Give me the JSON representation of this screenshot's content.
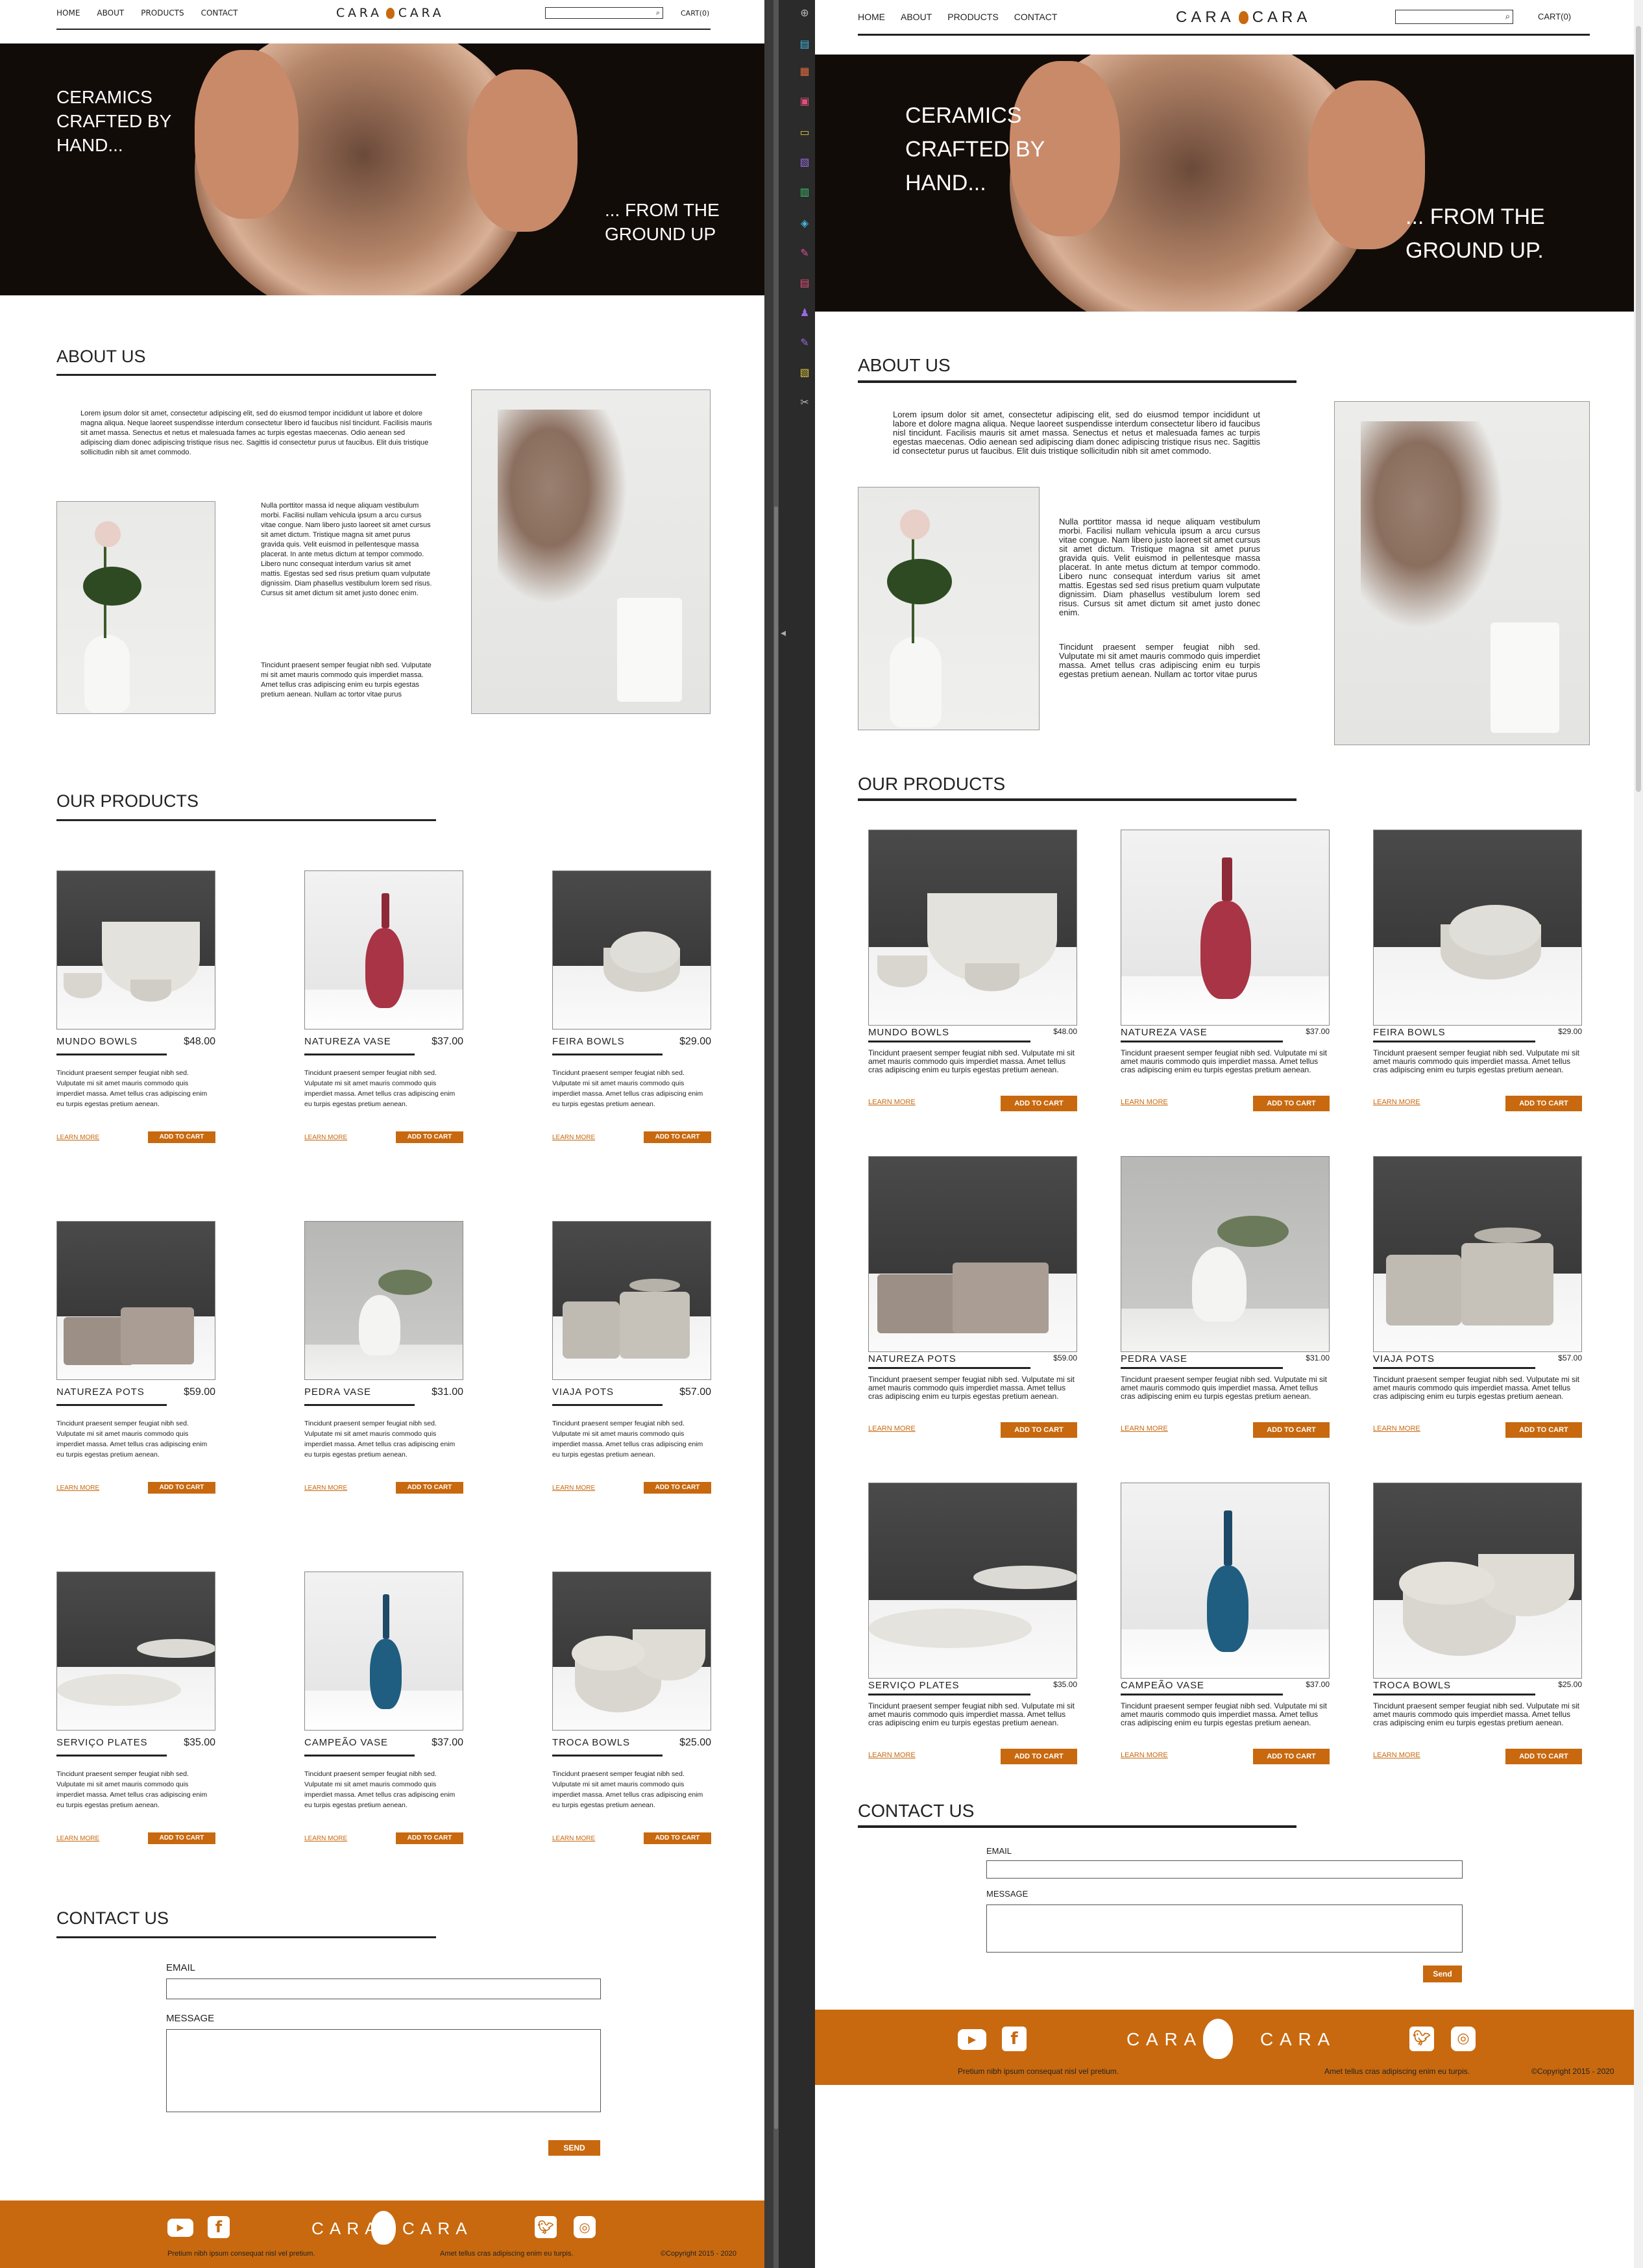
{
  "site": {
    "nav": [
      "HOME",
      "ABOUT",
      "PRODUCTS",
      "CONTACT"
    ],
    "logo_left": "CARA",
    "logo_right": "CARA",
    "cart": "CART(0)",
    "hero_line1": "CERAMICS\nCRAFTED BY\nHAND...",
    "about_title": "ABOUT US",
    "about_p1": "Lorem ipsum dolor sit amet, consectetur adipiscing elit, sed do eiusmod tempor incididunt ut labore et dolore magna aliqua. Neque laoreet suspendisse interdum consectetur libero id faucibus nisl tincidunt. Facilisis mauris sit amet massa. Senectus et netus et malesuada fames ac turpis egestas maecenas. Odio aenean sed adipiscing diam donec adipiscing tristique risus nec. Sagittis id consectetur purus ut faucibus. Elit duis tristique sollicitudin nibh sit amet commodo.",
    "about_p2": "Nulla porttitor massa id neque aliquam vestibulum morbi. Facilisi nullam vehicula ipsum a arcu cursus vitae congue. Nam libero justo laoreet sit amet cursus sit amet dictum. Tristique magna sit amet purus gravida quis. Velit euismod in pellentesque massa placerat. In ante metus dictum at tempor commodo. Libero nunc consequat interdum varius sit amet mattis. Egestas sed sed risus pretium quam vulputate dignissim. Diam phasellus vestibulum lorem sed risus. Cursus sit amet dictum sit amet justo donec enim.",
    "about_p3": "Tincidunt praesent semper feugiat nibh sed. Vulputate mi sit amet mauris commodo quis imperdiet massa. Amet tellus cras adipiscing enim eu turpis egestas pretium aenean. Nullam ac tortor vitae purus",
    "products_title": "OUR PRODUCTS",
    "product_desc": "Tincidunt praesent semper feugiat nibh sed. Vulputate mi sit amet mauris commodo quis imperdiet massa. Amet tellus cras adipiscing enim eu turpis egestas pretium aenean.",
    "learn_more": "LEARN MORE",
    "add_to_cart": "ADD TO CART",
    "contact_title": "CONTACT US",
    "email_label": "EMAIL",
    "message_label": "MESSAGE",
    "footer_left": "Pretium nibh ipsum consequat nisl vel pretium.",
    "footer_mid": "Amet tellus cras adipiscing enim eu turpis.",
    "footer_copy": "©Copyright 2015 - 2020"
  },
  "left": {
    "hero_line2": "... FROM THE\nGROUND UP",
    "send": "SEND"
  },
  "right": {
    "hero_line2": "... FROM THE\nGROUND UP.",
    "send": "Send"
  },
  "products": [
    {
      "name": "MUNDO BOWLS",
      "price_left": "$48.00",
      "price_right": "$48.00",
      "kind": "bowls"
    },
    {
      "name": "NATUREZA VASE",
      "price_left": "$37.00",
      "price_right": "$37.00",
      "kind": "redvase"
    },
    {
      "name": "FEIRA BOWLS",
      "price_left": "$29.00",
      "price_right": "$29.00",
      "kind": "stackbowls"
    },
    {
      "name": "NATUREZA POTS",
      "price_left": "$59.00",
      "price_right": "$59.00",
      "kind": "pots"
    },
    {
      "name": "PEDRA VASE",
      "price_left": "$31.00",
      "price_right": "$31.00",
      "kind": "whitevase"
    },
    {
      "name": "VIAJA POTS",
      "price_left": "$57.00",
      "price_right": "$57.00",
      "kind": "jars"
    },
    {
      "name": "SERVIÇO PLATES",
      "price_left": "$35.00",
      "price_right": "$35.00",
      "kind": "plates"
    },
    {
      "name": "CAMPEÃO VASE",
      "price_left": "$37.00",
      "price_right": "$37.00",
      "kind": "bluevase"
    },
    {
      "name": "TROCA BOWLS",
      "price_left": "$25.00",
      "price_right": "$25.00",
      "kind": "bowlstack"
    }
  ],
  "colors": {
    "accent": "#c8690f",
    "text": "#222222",
    "hero_bg": "#120c08"
  },
  "icons": [
    "youtube-icon",
    "facebook-icon",
    "twitter-icon",
    "instagram-icon",
    "search-icon"
  ]
}
